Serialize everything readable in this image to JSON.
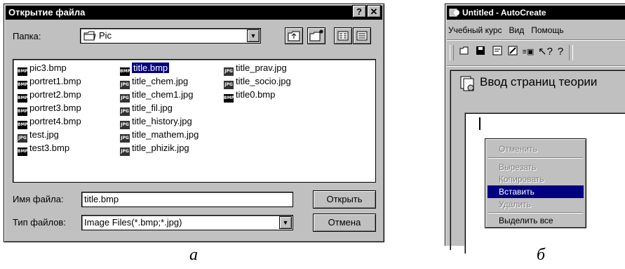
{
  "dialog": {
    "title": "Открытие файла",
    "help_btn": "?",
    "close_btn": "✕",
    "folder_label": "Папка:",
    "folder_value": "Pic",
    "files": [
      {
        "name": "pic3.bmp",
        "type": "BMP",
        "selected": false
      },
      {
        "name": "portret1.bmp",
        "type": "BMP",
        "selected": false
      },
      {
        "name": "portret2.bmp",
        "type": "BMP",
        "selected": false
      },
      {
        "name": "portret3.bmp",
        "type": "BMP",
        "selected": false
      },
      {
        "name": "portret4.bmp",
        "type": "BMP",
        "selected": false
      },
      {
        "name": "test.jpg",
        "type": "JPG",
        "selected": false
      },
      {
        "name": "test3.bmp",
        "type": "BMP",
        "selected": false
      },
      {
        "name": "title.bmp",
        "type": "BMP",
        "selected": true
      },
      {
        "name": "title_chem.jpg",
        "type": "JPG",
        "selected": false
      },
      {
        "name": "title_chem1.jpg",
        "type": "JPG",
        "selected": false
      },
      {
        "name": "title_fil.jpg",
        "type": "JPG",
        "selected": false
      },
      {
        "name": "title_history.jpg",
        "type": "JPG",
        "selected": false
      },
      {
        "name": "title_mathem.jpg",
        "type": "JPG",
        "selected": false
      },
      {
        "name": "title_phizik.jpg",
        "type": "JPG",
        "selected": false
      },
      {
        "name": "title_prav.jpg",
        "type": "JPG",
        "selected": false
      },
      {
        "name": "title_socio.jpg",
        "type": "JPG",
        "selected": false
      },
      {
        "name": "title0.bmp",
        "type": "BMP",
        "selected": false
      }
    ],
    "filename_label": "Имя файла:",
    "filename_value": "title.bmp",
    "filetype_label": "Тип файлов:",
    "filetype_value": "Image Files(*.bmp;*.jpg)",
    "open_btn": "Открыть",
    "cancel_btn": "Отмена"
  },
  "caption_a": "а",
  "window": {
    "title": "Untitled - AutoCreate",
    "menu": [
      "Учебный курс",
      "Вид",
      "Помощь"
    ],
    "heading": "Ввод страниц теории",
    "context_menu": [
      {
        "label": "Отменить",
        "disabled": true
      },
      {
        "label": "Вырезать",
        "disabled": true
      },
      {
        "label": "Копировать",
        "disabled": true
      },
      {
        "label": "Вставить",
        "disabled": false,
        "highlight": true
      },
      {
        "label": "Удалить",
        "disabled": true
      },
      {
        "label": "Выделить все",
        "disabled": false
      }
    ]
  },
  "caption_b": "б"
}
